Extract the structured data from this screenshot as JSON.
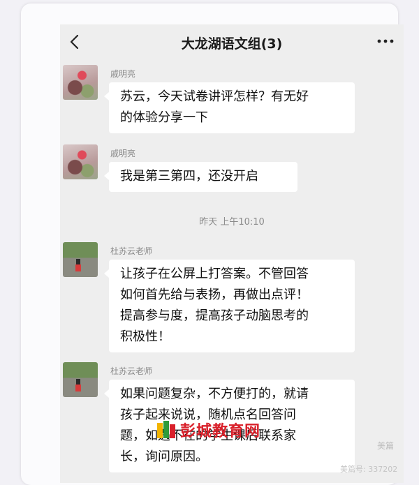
{
  "header": {
    "title": "大龙湖语文组(3)",
    "back_icon": "chevron-left-icon",
    "more_icon": "more-dots-icon"
  },
  "messages": [
    {
      "sender": "戚明亮",
      "avatar": "flower-photo-avatar",
      "lines": [
        "苏云，今天试卷讲评怎样？有无好",
        "的体验分享一下"
      ]
    },
    {
      "sender": "戚明亮",
      "avatar": "flower-photo-avatar",
      "lines": [
        "我是第三第四，还没开启"
      ]
    },
    {
      "sender": "杜苏云老师",
      "avatar": "child-photo-avatar",
      "lines": [
        "让孩子在公屏上打答案。不管回答",
        "如何首先给与表扬，再做出点评！",
        "提高参与度，提高孩子动脑思考的",
        "积极性！"
      ]
    },
    {
      "sender": "杜苏云老师",
      "avatar": "child-photo-avatar",
      "lines": [
        "如果问题复杂，不方便打的，就请",
        "孩子起来说说，随机点名回答问",
        "题，如遇不在的学生课后联系家",
        "长，询问原因。"
      ]
    }
  ],
  "timestamp": "昨天 上午10:10",
  "watermark": {
    "text": "彭城教育网",
    "side_mark": "美篇",
    "side_id": "美篇号: 337202"
  },
  "colors": {
    "background": "#eeeeee",
    "bubble": "#ffffff",
    "watermark": "#d9202a"
  }
}
